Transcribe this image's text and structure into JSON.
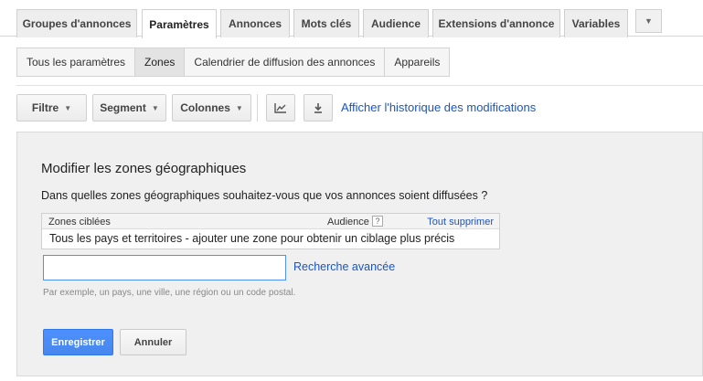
{
  "tabs": [
    {
      "label": "Groupes d'annonces",
      "active": false
    },
    {
      "label": "Paramètres",
      "active": true
    },
    {
      "label": "Annonces",
      "active": false
    },
    {
      "label": "Mots clés",
      "active": false
    },
    {
      "label": "Audience",
      "active": false
    },
    {
      "label": "Extensions d'annonce",
      "active": false
    },
    {
      "label": "Variables",
      "active": false
    }
  ],
  "tabs_more_icon": "chevron-down-icon",
  "subtabs": [
    {
      "label": "Tous les paramètres",
      "active": false
    },
    {
      "label": "Zones",
      "active": true
    },
    {
      "label": "Calendrier de diffusion des annonces",
      "active": false
    },
    {
      "label": "Appareils",
      "active": false
    }
  ],
  "toolbar": {
    "filter_label": "Filtre",
    "segment_label": "Segment",
    "columns_label": "Colonnes",
    "chart_icon": "line-chart-icon",
    "download_icon": "download-icon",
    "history_link": "Afficher l'historique des modifications"
  },
  "panel": {
    "title": "Modifier les zones géographiques",
    "question": "Dans quelles zones géographiques souhaitez-vous que vos annonces soient diffusées ?",
    "table": {
      "col_targeted": "Zones ciblées",
      "col_audience": "Audience",
      "help_icon_label": "?",
      "clear_all": "Tout supprimer",
      "row_text": "Tous les pays et territoires - ajouter une zone pour obtenir un ciblage plus précis"
    },
    "search": {
      "value": "",
      "placeholder": ""
    },
    "advanced_search": "Recherche avancée",
    "hint": "Par exemple, un pays, une ville, une région ou un code postal.",
    "save_label": "Enregistrer",
    "cancel_label": "Annuler"
  },
  "colors": {
    "accent_blue": "#4d90fe",
    "link_blue": "#1a55c3",
    "panel_bg": "#f0f0f0"
  }
}
